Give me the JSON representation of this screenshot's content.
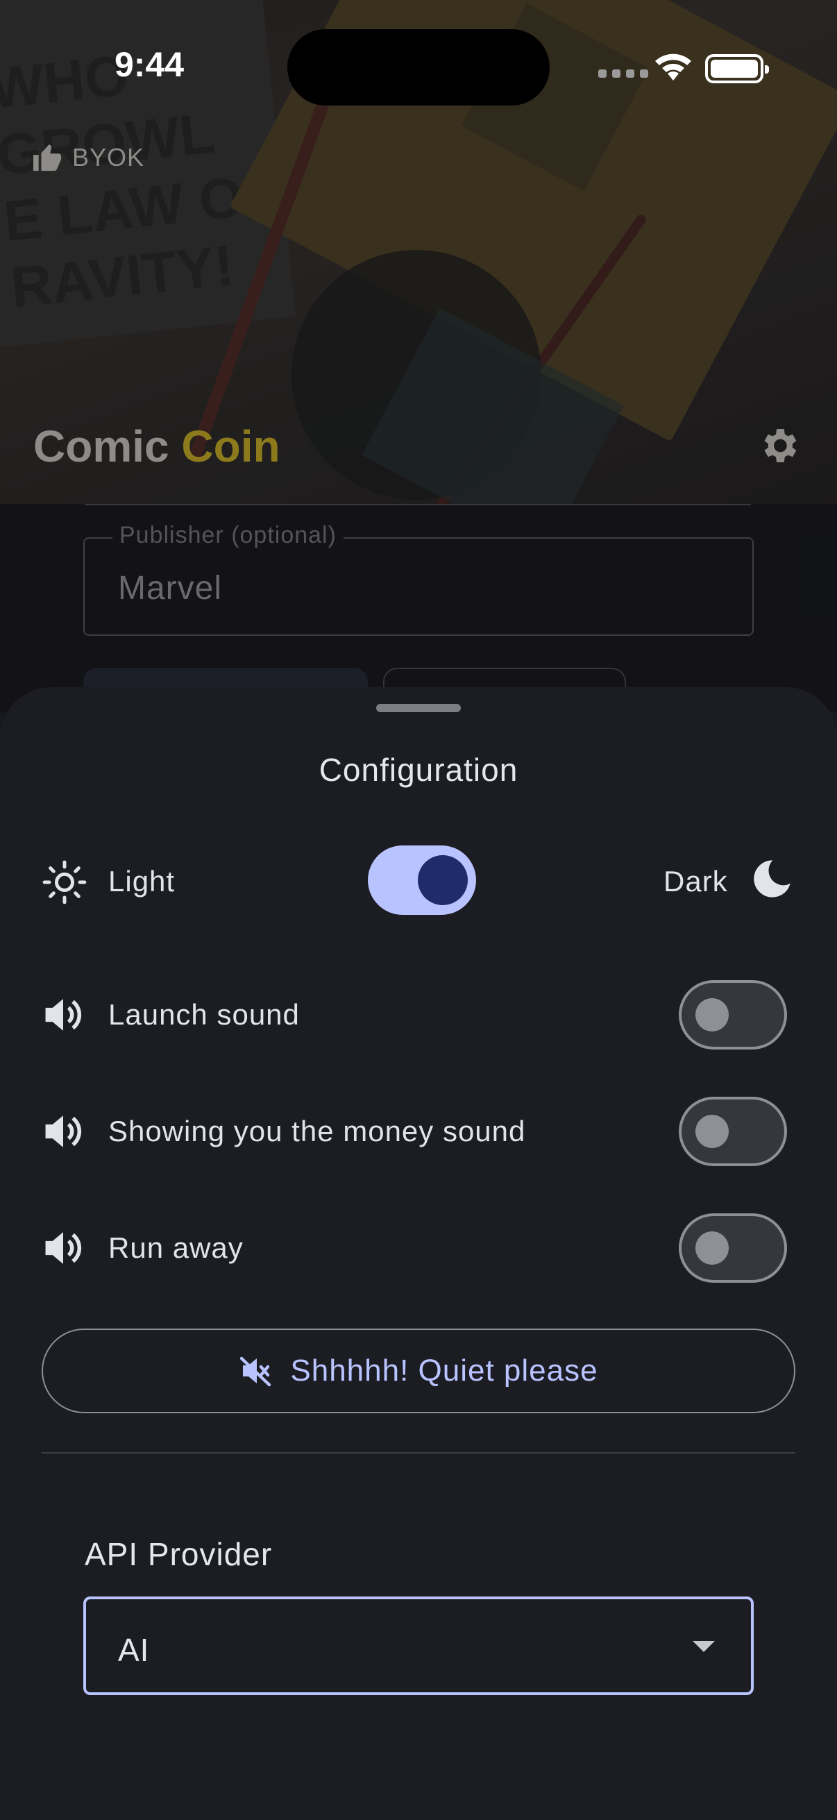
{
  "status_bar": {
    "time": "9:44"
  },
  "header": {
    "byok_label": "BYOK",
    "brand_part1": "Comic ",
    "brand_part2": "Coin",
    "background_text": "WHO\nGROWL\nE LAW OF\nRAVITY!"
  },
  "form": {
    "publisher_label": "Publisher (optional)",
    "publisher_value": "Marvel"
  },
  "sheet": {
    "title": "Configuration",
    "theme": {
      "light_label": "Light",
      "dark_label": "Dark",
      "dark_enabled": true
    },
    "sounds": [
      {
        "label": "Launch sound",
        "enabled": false
      },
      {
        "label": "Showing you the money sound",
        "enabled": false
      },
      {
        "label": "Run away",
        "enabled": false
      }
    ],
    "quiet_button_label": "Shhhhh! Quiet please",
    "api_provider": {
      "label": "API Provider",
      "selected": "AI"
    }
  },
  "colors": {
    "accent": "#b8c3ff",
    "switch_knob_on": "#1f2b6b",
    "brand_gold": "#8d7a1c",
    "sheet_bg": "#1c1d23"
  }
}
